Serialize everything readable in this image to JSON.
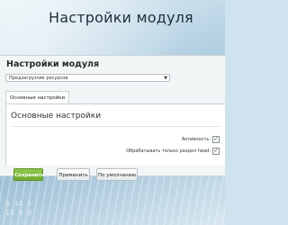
{
  "hero": {
    "title": "Настройки модуля"
  },
  "page": {
    "title": "Настройки модуля",
    "star_icon": "star-icon"
  },
  "module_select": {
    "value": "Предзагрузчик ресурсов",
    "caret_icon": "chevron-down-icon"
  },
  "tabs": [
    {
      "label": "Основные настройки"
    }
  ],
  "section": {
    "title": "Основные настройки"
  },
  "options": [
    {
      "label": "Активность:",
      "checked": true
    },
    {
      "label": "Обрабатывать только раздел head:",
      "checked": true
    }
  ],
  "buttons": {
    "save": "Сохранить",
    "apply": "Применить",
    "default": "По умолчанию"
  },
  "background_text": {
    "line1": "9 14 5",
    "line2": "15 4 0"
  }
}
